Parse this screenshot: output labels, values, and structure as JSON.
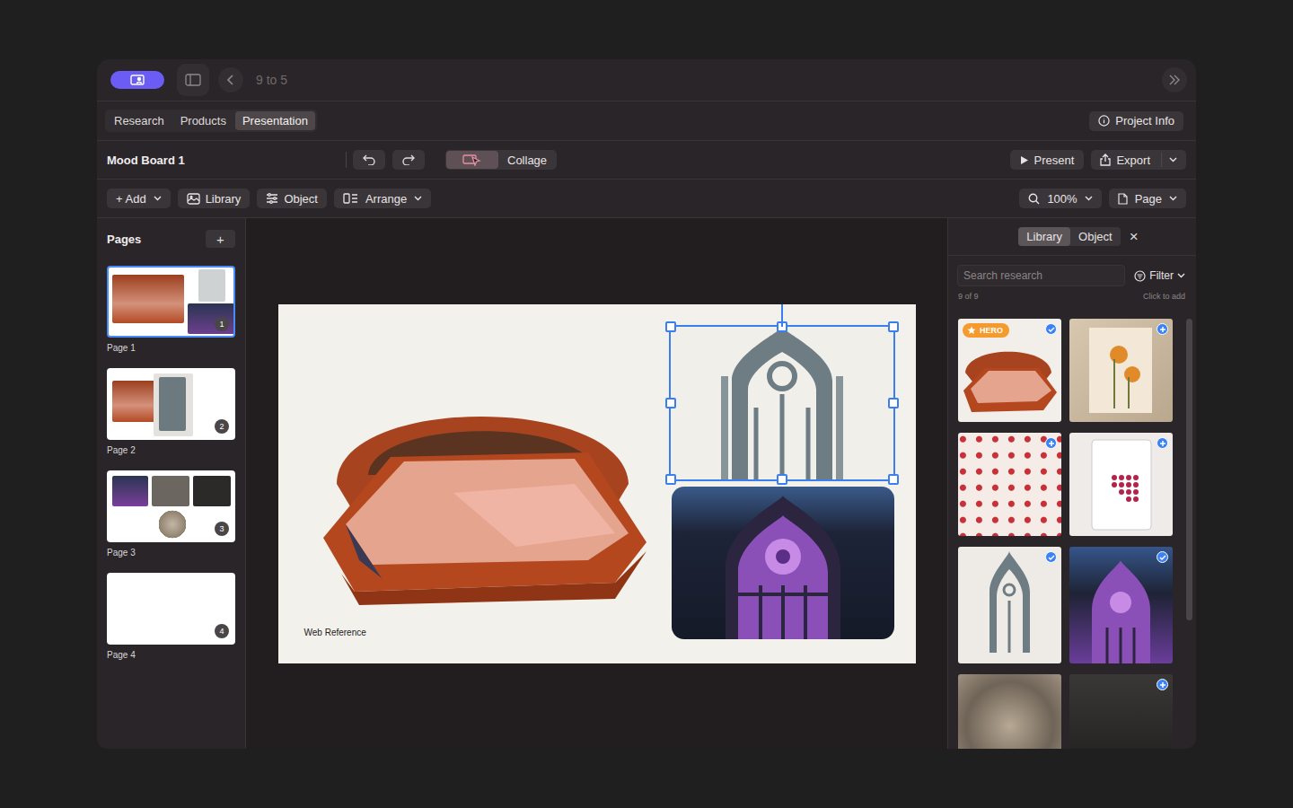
{
  "window": {
    "title": "9 to 5"
  },
  "tabs": [
    {
      "label": "Research",
      "selected": false
    },
    {
      "label": "Products",
      "selected": false
    },
    {
      "label": "Presentation",
      "selected": true
    }
  ],
  "project_info": "Project Info",
  "document": {
    "name": "Mood Board 1"
  },
  "view_toggle": {
    "icon_selected": true,
    "label": "Collage",
    "collage_selected": false
  },
  "actions": {
    "present": "Present",
    "export": "Export"
  },
  "toolbar": {
    "add": "+ Add",
    "library": "Library",
    "object": "Object",
    "arrange": "Arrange",
    "zoom": "100%",
    "page": "Page"
  },
  "pages": {
    "title": "Pages",
    "add": "+",
    "items": [
      {
        "label": "Page 1",
        "number": "1",
        "selected": true
      },
      {
        "label": "Page 2",
        "number": "2",
        "selected": false
      },
      {
        "label": "Page 3",
        "number": "3",
        "selected": false
      },
      {
        "label": "Page 4",
        "number": "4",
        "selected": false
      }
    ]
  },
  "canvas": {
    "elements": [
      {
        "kind": "bed",
        "selected": false
      },
      {
        "kind": "arch",
        "selected": true
      },
      {
        "kind": "photo",
        "selected": false
      },
      {
        "kind": "text",
        "text": "Web Reference",
        "selected": false
      }
    ]
  },
  "panel": {
    "tabs": [
      {
        "label": "Library",
        "selected": true
      },
      {
        "label": "Object",
        "selected": false
      }
    ],
    "close": "×",
    "search": {
      "placeholder": "Search research"
    },
    "filter": "Filter",
    "count": "9 of 9",
    "hint": "Click to add",
    "items": [
      {
        "tag": "HERO",
        "kind": "check"
      },
      {
        "kind": "plus"
      },
      {
        "kind": "plus"
      },
      {
        "kind": "plus"
      },
      {
        "kind": "check"
      },
      {
        "kind": "check"
      },
      {
        "kind": "none"
      },
      {
        "kind": "plus"
      }
    ]
  }
}
